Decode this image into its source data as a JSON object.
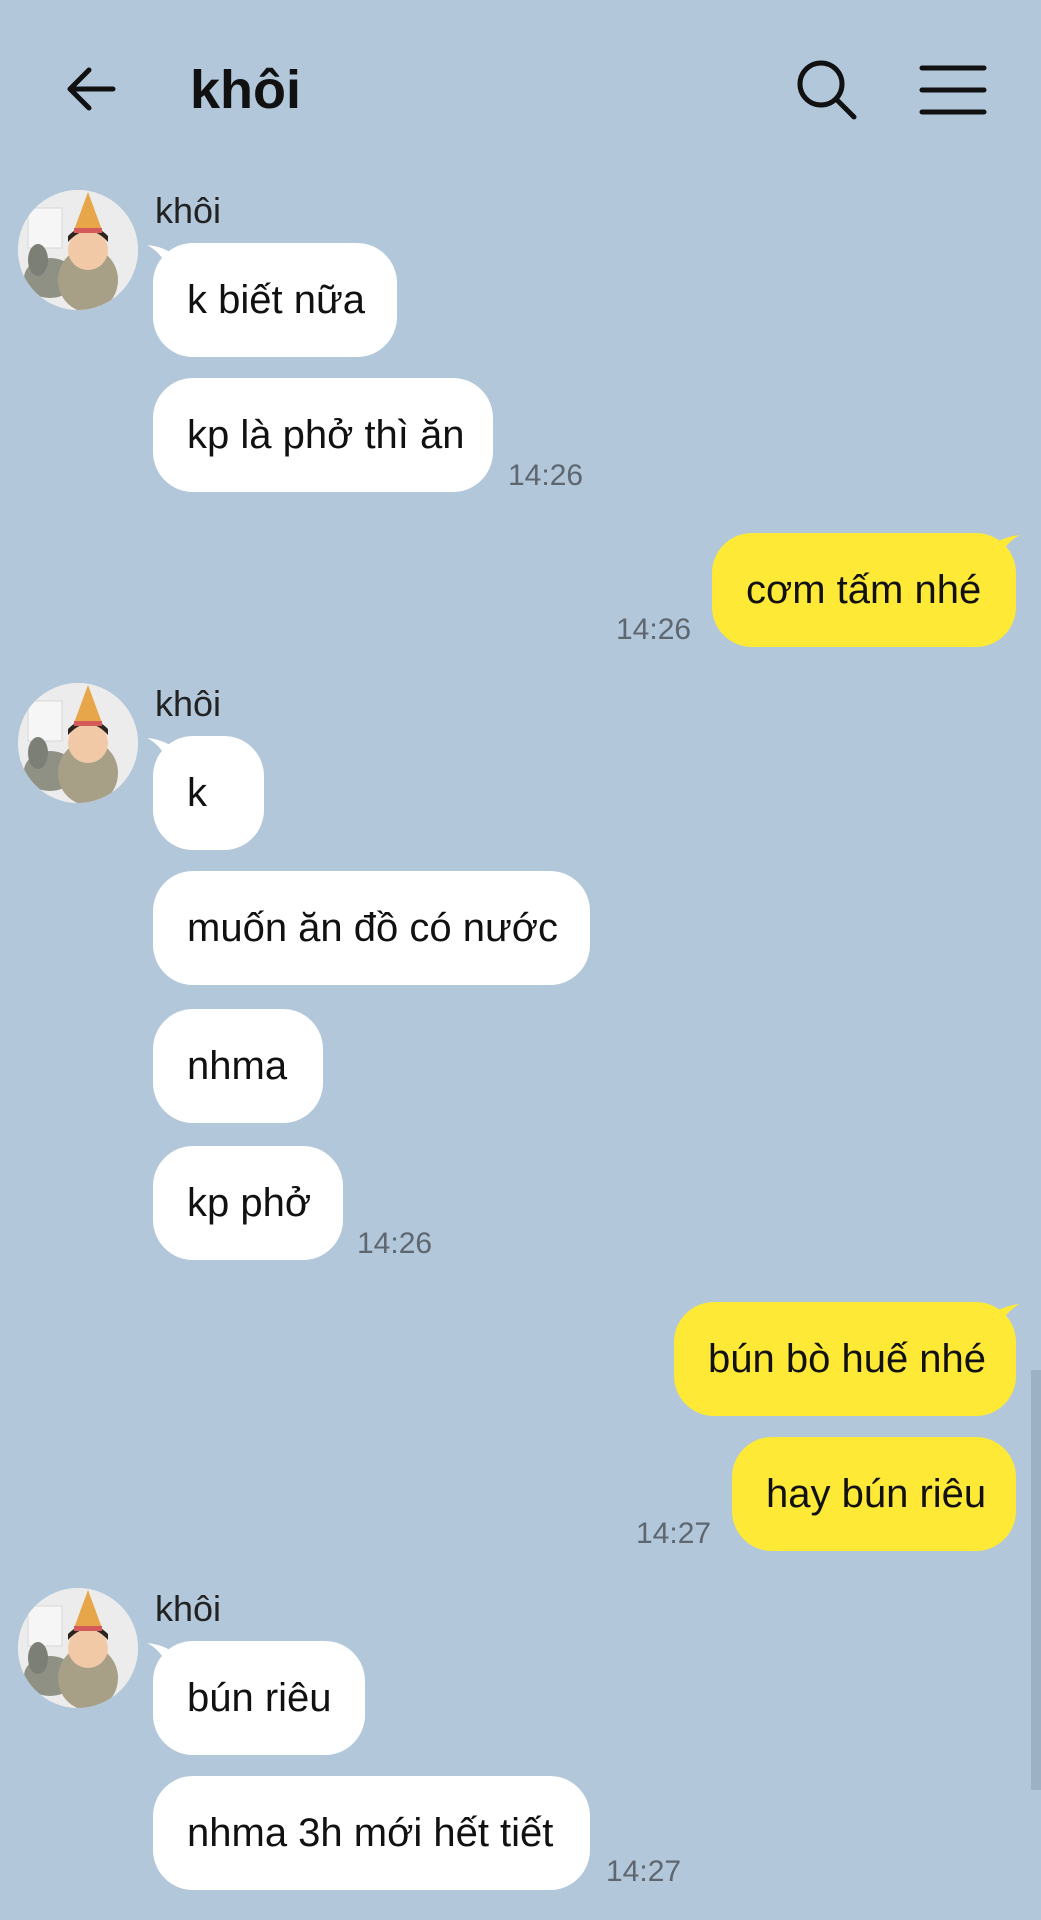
{
  "header": {
    "title": "khôi",
    "back_icon": "arrow-left-icon",
    "search_icon": "search-icon",
    "menu_icon": "hamburger-menu-icon"
  },
  "colors": {
    "background": "#b2c7da",
    "incoming_bubble": "#ffffff",
    "outgoing_bubble": "#fee936",
    "timestamp": "#5e6670"
  },
  "messages": {
    "g1": {
      "sender": "khôi",
      "m1": "k biết nữa",
      "m2": "kp là phở thì ăn",
      "time": "14:26"
    },
    "g2": {
      "m1": "cơm tấm nhé",
      "time": "14:26"
    },
    "g3": {
      "sender": "khôi",
      "m1": "k",
      "m2": "muốn ăn đồ có nước",
      "m3": "nhma",
      "m4": "kp phở",
      "time": "14:26"
    },
    "g4": {
      "m1": "bún bò huế nhé",
      "m2": "hay bún riêu",
      "time": "14:27"
    },
    "g5": {
      "sender": "khôi",
      "m1": "bún riêu",
      "m2": "nhma 3h mới hết tiết",
      "time": "14:27"
    }
  }
}
